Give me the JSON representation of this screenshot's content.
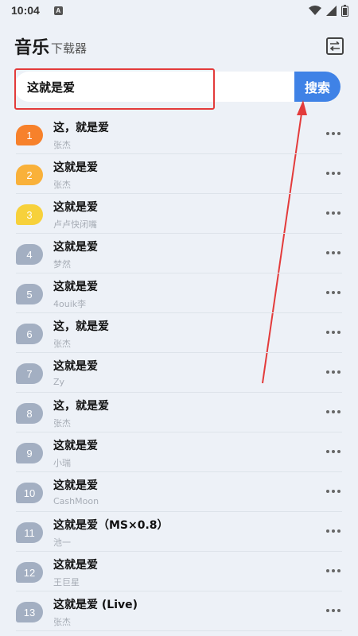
{
  "status_bar": {
    "time": "10:04",
    "notification_badge": "A"
  },
  "header": {
    "title": "音乐",
    "subtitle": "下载器",
    "icon": "switch-icon"
  },
  "search": {
    "value": "这就是爱",
    "button_label": "搜索"
  },
  "colors": {
    "rank_1": "#f7812b",
    "rank_2": "#f9b13a",
    "rank_3": "#f7d13b",
    "rank_default": "#a3afc2",
    "accent": "#3f82e6",
    "highlight": "#e33b3b"
  },
  "songs": [
    {
      "rank": "1",
      "title": "这，就是爱",
      "artist": "张杰"
    },
    {
      "rank": "2",
      "title": "这就是爱",
      "artist": "张杰"
    },
    {
      "rank": "3",
      "title": "这就是爱",
      "artist": "卢卢快闭嘴"
    },
    {
      "rank": "4",
      "title": "这就是爱",
      "artist": "梦然"
    },
    {
      "rank": "5",
      "title": "这就是爱",
      "artist": "4ouik李"
    },
    {
      "rank": "6",
      "title": "这，就是爱",
      "artist": "张杰"
    },
    {
      "rank": "7",
      "title": "这就是爱",
      "artist": "Zy"
    },
    {
      "rank": "8",
      "title": "这，就是爱",
      "artist": "张杰"
    },
    {
      "rank": "9",
      "title": "这就是爱",
      "artist": "小瑞"
    },
    {
      "rank": "10",
      "title": "这就是爱",
      "artist": "CashMoon"
    },
    {
      "rank": "11",
      "title": "这就是爱（MS×0.8）",
      "artist": "池一"
    },
    {
      "rank": "12",
      "title": "这就是爱",
      "artist": "王巨星"
    },
    {
      "rank": "13",
      "title": "这就是爱 (Live)",
      "artist": "张杰"
    }
  ]
}
